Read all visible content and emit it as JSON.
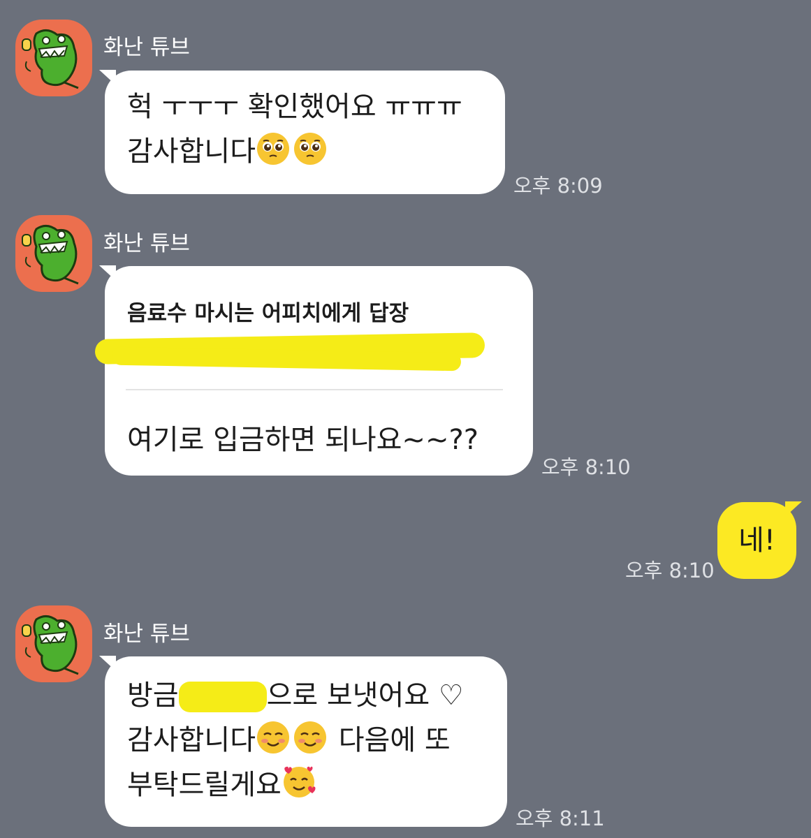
{
  "messages": [
    {
      "sender": "화난 튜브",
      "line1": "헉 ㅜㅜㅜ 확인했어요 ㅠㅠㅠ",
      "line2": "감사합니다",
      "line2_emojis": [
        "pleading-face",
        "pleading-face"
      ],
      "time": "오후 8:09"
    },
    {
      "sender": "화난 튜브",
      "reply_title": "음료수 마시는 어피치에게 답장",
      "text": "여기로 입금하면 되나요~~??",
      "time": "오후 8:10"
    },
    {
      "self": true,
      "text": "네!",
      "time": "오후 8:10"
    },
    {
      "sender": "화난 튜브",
      "line1_prefix": "방금",
      "line1_suffix": "으로 보냇어요 ♡",
      "line2_prefix": "감사합니다",
      "line2_emojis": [
        "smiling-face",
        "smiling-face"
      ],
      "line2_suffix": " 다음에 또",
      "line3": "부탁드릴게요",
      "line3_emoji": "smiling-face-with-hearts",
      "time": "오후 8:11"
    }
  ],
  "colors": {
    "background": "#6b707b",
    "incoming_bubble": "#ffffff",
    "outgoing_bubble": "#fce923",
    "avatar_bg": "#ec6f4e",
    "highlight": "#f5ec17"
  }
}
